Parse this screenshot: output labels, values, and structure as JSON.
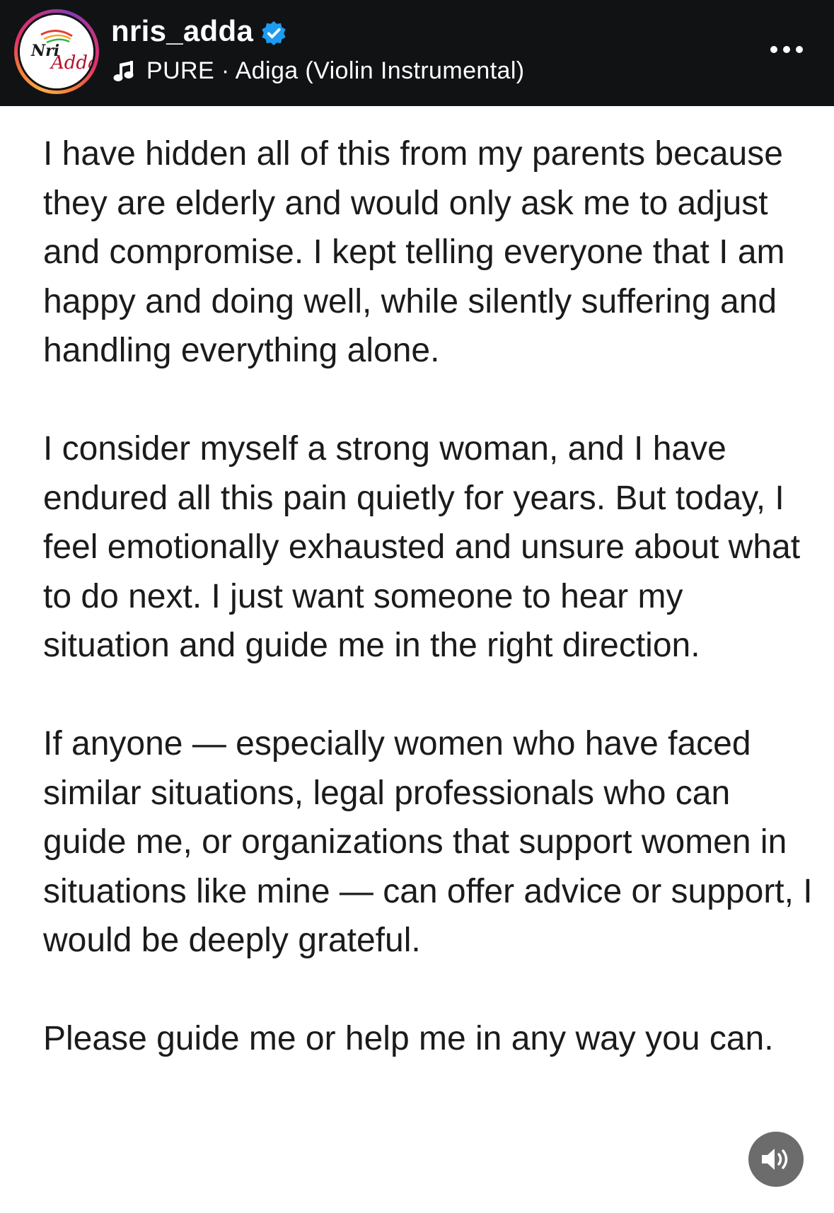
{
  "header": {
    "username": "nris_adda",
    "avatar_logo_text": "Nri Adda",
    "verified_icon": "verified-badge-icon",
    "music_icon": "music-note-icon",
    "audio_track": "PURE · Adiga (Violin Instrumental)",
    "more_icon": "more-options-icon",
    "background_color": "#111214",
    "verified_color": "#1d9bf0"
  },
  "post": {
    "paragraphs": [
      "I have hidden all of this from my parents because they are elderly and would only ask me to adjust and compromise. I kept telling everyone that I am happy and doing well, while silently suffering and handling everything alone.",
      "I consider myself a strong woman, and I have endured all this pain quietly for years. But today, I feel emotionally exhausted and unsure about what to do next. I just want someone to hear my situation and guide me in the right direction.",
      "If anyone — especially women who have faced similar situations, legal professionals who can guide me, or organizations that support women in situations like mine — can offer advice or support, I would be deeply grateful.",
      "Please guide me or help me in any way you can."
    ]
  },
  "controls": {
    "sound_icon": "speaker-icon"
  }
}
